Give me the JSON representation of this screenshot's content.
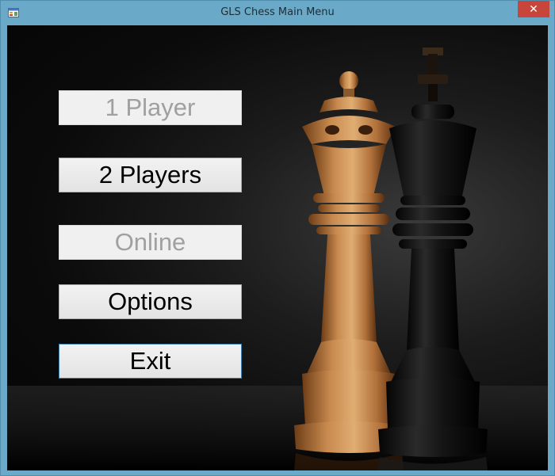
{
  "window": {
    "title": "GLS Chess Main Menu",
    "close_glyph": "✕",
    "icon": "windows-form-icon"
  },
  "menu": {
    "buttons": [
      {
        "label": "1 Player",
        "enabled": false
      },
      {
        "label": "2 Players",
        "enabled": true
      },
      {
        "label": "Online",
        "enabled": false
      },
      {
        "label": "Options",
        "enabled": true
      },
      {
        "label": "Exit",
        "enabled": true,
        "focused": true
      }
    ]
  },
  "background": {
    "image": "chess-queen-and-king-pieces"
  }
}
